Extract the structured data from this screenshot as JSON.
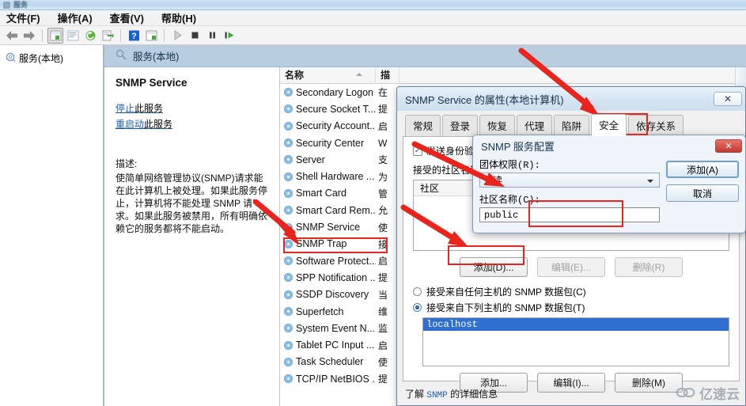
{
  "window": {
    "titlebar_text": "服务",
    "menu": [
      {
        "label": "文件(F)",
        "name": "menu-file"
      },
      {
        "label": "操作(A)",
        "name": "menu-action"
      },
      {
        "label": "查看(V)",
        "name": "menu-view"
      },
      {
        "label": "帮助(H)",
        "name": "menu-help"
      }
    ],
    "toolbar": [
      {
        "name": "back-icon",
        "glyph": "◀"
      },
      {
        "name": "forward-icon",
        "glyph": "▶"
      },
      {
        "name": "show-hide-tree-icon",
        "glyph": "▤"
      },
      {
        "name": "properties-icon",
        "glyph": "▤"
      },
      {
        "name": "refresh-icon",
        "glyph": "⟳"
      },
      {
        "name": "export-list-icon",
        "glyph": "⇨"
      },
      {
        "name": "help-icon",
        "glyph": "?"
      },
      {
        "name": "view-icon",
        "glyph": "▦"
      },
      {
        "name": "start-service-icon",
        "glyph": "▶"
      },
      {
        "name": "stop-service-icon",
        "glyph": "■"
      },
      {
        "name": "pause-service-icon",
        "glyph": "❚❚"
      },
      {
        "name": "restart-service-icon",
        "glyph": "▶❚"
      }
    ]
  },
  "tree": {
    "root_label": "服务(本地)"
  },
  "pane": {
    "header_label": "服务(本地)"
  },
  "detail": {
    "service_title": "SNMP Service",
    "links": [
      {
        "link": "停止",
        "tail": "此服务"
      },
      {
        "link": "重启动",
        "tail": "此服务"
      }
    ],
    "description_label": "描述:",
    "description": "使简单网络管理协议(SNMP)请求能在此计算机上被处理。如果此服务停止，计算机将不能处理 SNMP 请求。如果此服务被禁用，所有明确依赖它的服务都将不能启动。"
  },
  "services_list": {
    "columns": [
      "名称",
      "描"
    ],
    "rows": [
      {
        "name": "Secondary Logon",
        "desc": "在"
      },
      {
        "name": "Secure Socket T...",
        "desc": "提"
      },
      {
        "name": "Security Account...",
        "desc": "启"
      },
      {
        "name": "Security Center",
        "desc": "W"
      },
      {
        "name": "Server",
        "desc": "支"
      },
      {
        "name": "Shell Hardware ...",
        "desc": "为"
      },
      {
        "name": "Smart Card",
        "desc": "管"
      },
      {
        "name": "Smart Card Rem...",
        "desc": "允"
      },
      {
        "name": "SNMP Service",
        "desc": "使",
        "selected": true
      },
      {
        "name": "SNMP Trap",
        "desc": "接"
      },
      {
        "name": "Software Protect...",
        "desc": "启"
      },
      {
        "name": "SPP Notification ...",
        "desc": "提"
      },
      {
        "name": "SSDP Discovery",
        "desc": "当"
      },
      {
        "name": "Superfetch",
        "desc": "维"
      },
      {
        "name": "System Event N...",
        "desc": "监"
      },
      {
        "name": "Tablet PC Input ...",
        "desc": "启"
      },
      {
        "name": "Task Scheduler",
        "desc": "使"
      },
      {
        "name": "TCP/IP NetBIOS ...",
        "desc": "提"
      }
    ]
  },
  "properties_dialog": {
    "title": "SNMP Service 的属性(本地计算机)",
    "close_label": "✕",
    "tabs": [
      {
        "label": "常规",
        "name": "tab-general"
      },
      {
        "label": "登录",
        "name": "tab-logon"
      },
      {
        "label": "恢复",
        "name": "tab-recovery"
      },
      {
        "label": "代理",
        "name": "tab-agent"
      },
      {
        "label": "陷阱",
        "name": "tab-traps"
      },
      {
        "label": "安全",
        "name": "tab-security",
        "active": true
      },
      {
        "label": "依存关系",
        "name": "tab-dependencies"
      }
    ],
    "security": {
      "send_auth_trap_label": "发送身份验证陷阱(N)",
      "send_auth_trap_checked": "✓",
      "accepted_communities_label": "接受的社区名称(M)",
      "community_column": "社区",
      "community_buttons": [
        {
          "label": "添加(D)...",
          "name": "add-community-button",
          "enabled": true
        },
        {
          "label": "编辑(E)...",
          "name": "edit-community-button",
          "enabled": false
        },
        {
          "label": "删除(R)",
          "name": "remove-community-button",
          "enabled": false
        }
      ],
      "radio_any_host": "接受来自任何主机的 SNMP 数据包(C)",
      "radio_listed_host": "接受来自下列主机的 SNMP 数据包(T)",
      "selected_radio": "listed",
      "host_list": [
        "localhost"
      ],
      "host_buttons": [
        {
          "label": "添加...",
          "name": "add-host-button",
          "enabled": true
        },
        {
          "label": "编辑(I)...",
          "name": "edit-host-button",
          "enabled": true
        },
        {
          "label": "删除(M)",
          "name": "remove-host-button",
          "enabled": true
        }
      ],
      "learn_more_prefix": "了解 ",
      "learn_more_link": "SNMP",
      "learn_more_suffix": " 的详细信息"
    }
  },
  "config_dialog": {
    "title": "SNMP 服务配置",
    "close_label": "✕",
    "permission_label": "团体权限(R):",
    "permission_value": "只读",
    "community_name_label": "社区名称(C):",
    "community_name_value": "public",
    "add_button": "添加(A)",
    "cancel_button": "取消"
  },
  "watermark": {
    "text": "亿速云",
    "mark": "66"
  },
  "colors": {
    "accent_red": "#e8241c",
    "selection_blue": "#2f6fd0",
    "pane_header": "#b8cde0",
    "link_blue": "#1a5fb4"
  }
}
